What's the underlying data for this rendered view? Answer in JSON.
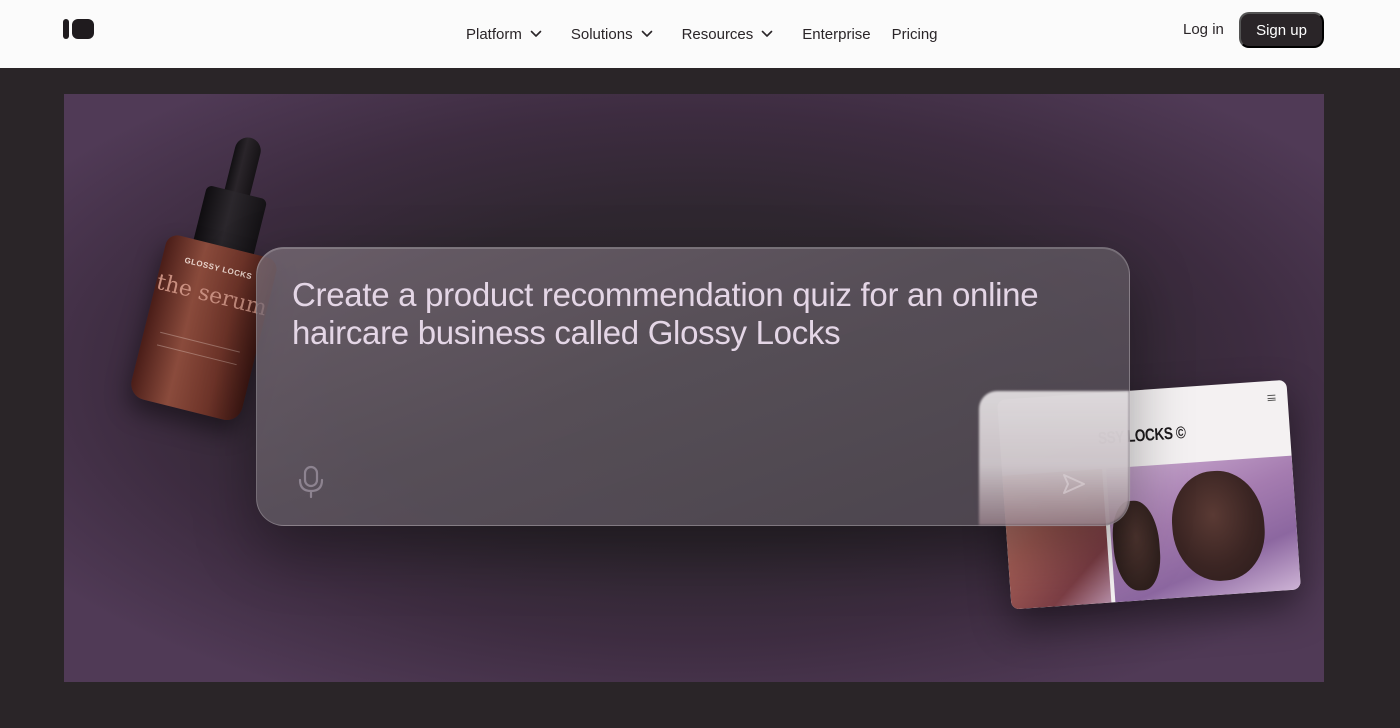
{
  "header": {
    "nav": [
      {
        "label": "Platform",
        "has_dropdown": true
      },
      {
        "label": "Solutions",
        "has_dropdown": true
      },
      {
        "label": "Resources",
        "has_dropdown": true
      },
      {
        "label": "Enterprise",
        "has_dropdown": false
      },
      {
        "label": "Pricing",
        "has_dropdown": false
      }
    ],
    "login_label": "Log in",
    "signup_label": "Sign up"
  },
  "hero": {
    "prompt_text": "Create a product recommendation quiz for an online haircare business called Glossy Locks",
    "bottle": {
      "brand": "GLOSSY LOCKS",
      "product": "the serum"
    },
    "preview": {
      "brand": "SSY LOCKS ©"
    }
  },
  "colors": {
    "header_bg": "#fbfbfb",
    "page_bg": "#2a2528",
    "signup_bg": "#2a2528",
    "prompt_text": "#e4d6e6",
    "hero_edge": "#503a56"
  },
  "icons": [
    "logo-icon",
    "chevron-down-icon",
    "microphone-icon",
    "send-icon",
    "menu-icon"
  ]
}
